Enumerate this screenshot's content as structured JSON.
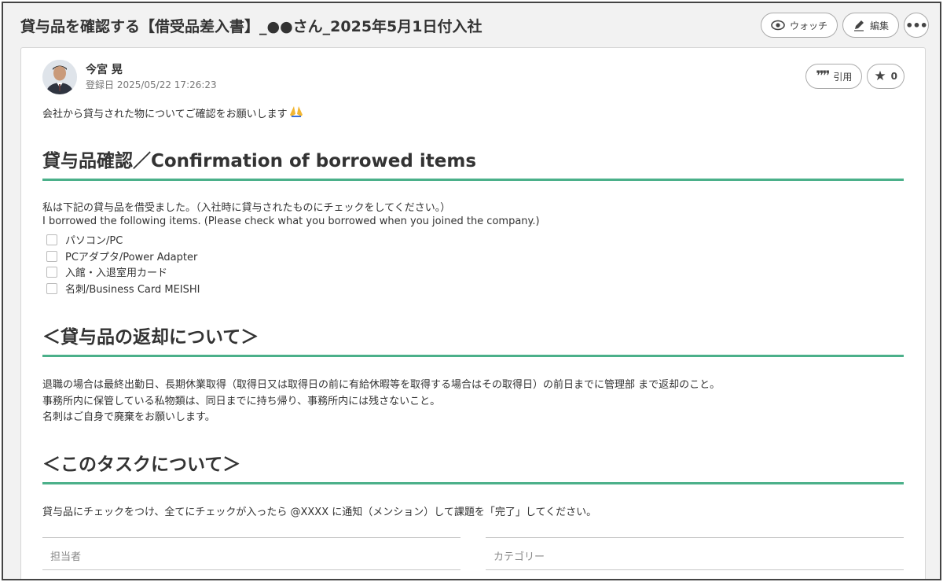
{
  "page": {
    "title": "貸与品を確認する【借受品差入書】_●●さん_2025年5月1日付入社",
    "watch_label": "ウォッチ",
    "edit_label": "編集",
    "more_label": "•••"
  },
  "comment": {
    "author": "今宮 晃",
    "date": "登録日  2025/05/22 17:26:23",
    "quote_label": "引用",
    "star_count": "0",
    "intro": "会社から貸与された物についてご確認をお願いします"
  },
  "section1": {
    "heading": "貸与品確認／Confirmation of borrowed items",
    "line1": "私は下記の貸与品を借受ました。（入社時に貸与されたものにチェックをしてください。）",
    "line2": "I borrowed the following items. (Please check what you borrowed when you joined the company.)",
    "items": [
      "パソコン/PC",
      "PCアダプタ/Power Adapter",
      "入館・入退室用カード",
      "名刺/Business Card MEISHI"
    ]
  },
  "section2": {
    "heading": "＜貸与品の返却について＞",
    "lines": [
      "退職の場合は最終出勤日、長期休業取得（取得日又は取得日の前に有給休暇等を取得する場合はその取得日）の前日までに管理部 まで返却のこと。",
      "事務所内に保管している私物類は、同日までに持ち帰り、事務所内には残さないこと。",
      "名刺はご自身で廃棄をお願いします。"
    ]
  },
  "section3": {
    "heading": "＜このタスクについて＞",
    "line": "貸与品にチェックをつけ、全てにチェックが入ったら @XXXX に通知（メンション）して課題を「完了」してください。"
  },
  "fields": {
    "assignee_label": "担当者",
    "category_label": "カテゴリー"
  },
  "colors": {
    "accent": "#4bb08a",
    "background": "#f2f2f2"
  }
}
